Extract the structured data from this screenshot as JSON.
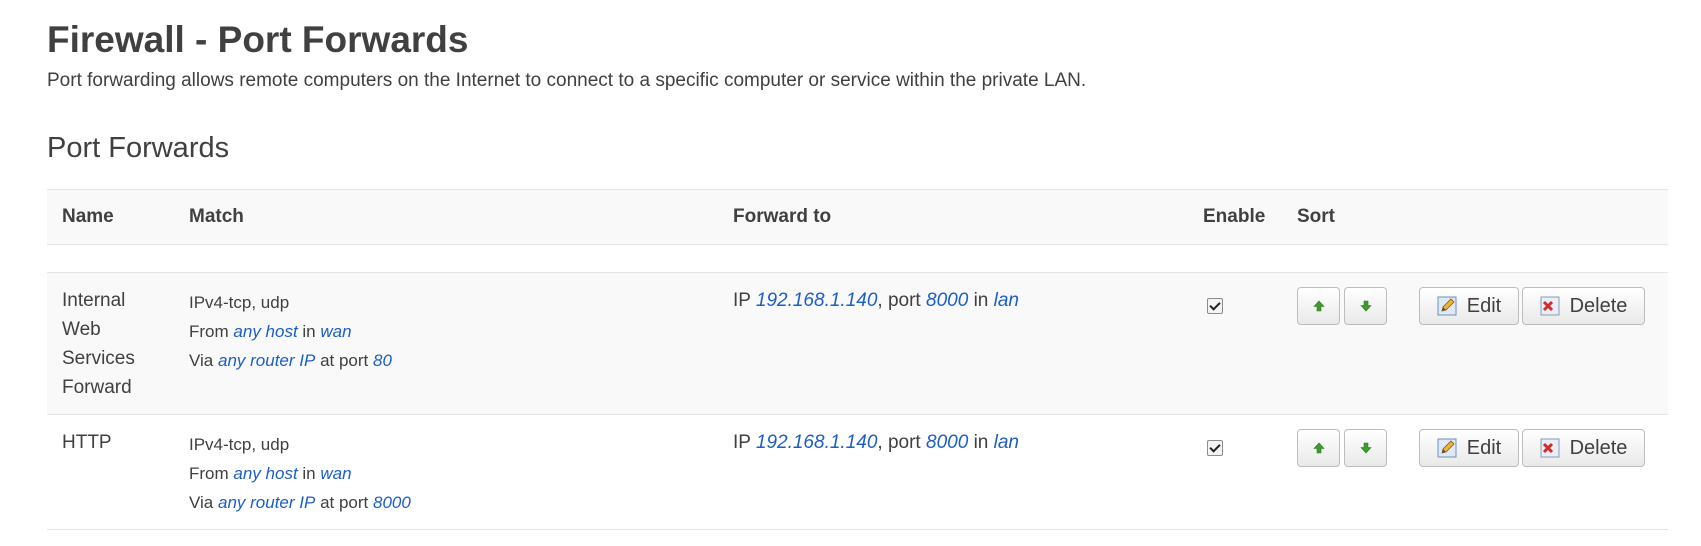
{
  "page": {
    "title": "Firewall - Port Forwards",
    "description": "Port forwarding allows remote computers on the Internet to connect to a specific computer or service within the private LAN."
  },
  "section": {
    "title": "Port Forwards"
  },
  "table": {
    "headers": {
      "name": "Name",
      "match": "Match",
      "forward": "Forward to",
      "enable": "Enable",
      "sort": "Sort"
    },
    "rows": [
      {
        "name": "Internal Web Services Forward",
        "match": {
          "proto": "IPv4-tcp, udp",
          "from_label": "From",
          "from_host": "any host",
          "in_label": "in",
          "from_zone": "wan",
          "via_label": "Via",
          "via_ip": "any router IP",
          "at_port_label": "at port",
          "via_port": "80"
        },
        "forward": {
          "ip_label": "IP",
          "ip": "192.168.1.140",
          "port_label": ", port",
          "port": "8000",
          "in_label": "in",
          "zone": "lan"
        },
        "enabled": true,
        "edit_label": "Edit",
        "delete_label": "Delete"
      },
      {
        "name": "HTTP",
        "match": {
          "proto": "IPv4-tcp, udp",
          "from_label": "From",
          "from_host": "any host",
          "in_label": "in",
          "from_zone": "wan",
          "via_label": "Via",
          "via_ip": "any router IP",
          "at_port_label": "at port",
          "via_port": "8000"
        },
        "forward": {
          "ip_label": "IP",
          "ip": "192.168.1.140",
          "port_label": ", port",
          "port": "8000",
          "in_label": "in",
          "zone": "lan"
        },
        "enabled": true,
        "edit_label": "Edit",
        "delete_label": "Delete"
      }
    ]
  },
  "icons": {
    "sort_up": "arrow-up-icon",
    "sort_down": "arrow-down-icon",
    "edit": "edit-icon",
    "delete": "delete-icon"
  },
  "colors": {
    "link": "#1b5ec7",
    "text": "#404040",
    "header_bg": "#f9f9f9"
  }
}
